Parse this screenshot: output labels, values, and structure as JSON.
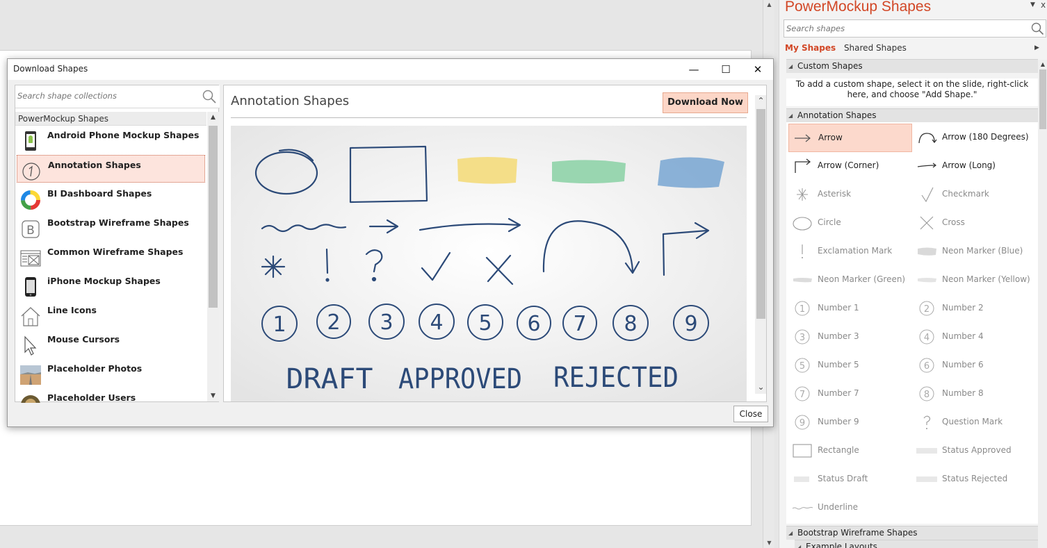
{
  "dialog": {
    "title": "Download Shapes",
    "minimize": "—",
    "maximize": "☐",
    "close": "✕",
    "search_placeholder": "Search shape collections",
    "list_header": "PowerMockup Shapes",
    "items": [
      {
        "label": "Android Phone Mockup Shapes",
        "icon": "android-phone-icon"
      },
      {
        "label": "Annotation Shapes",
        "icon": "annotation-number-icon"
      },
      {
        "label": "BI Dashboard Shapes",
        "icon": "donut-chart-icon"
      },
      {
        "label": "Bootstrap Wireframe Shapes",
        "icon": "bootstrap-b-icon"
      },
      {
        "label": "Common Wireframe Shapes",
        "icon": "wireframe-icon"
      },
      {
        "label": "iPhone Mockup Shapes",
        "icon": "iphone-icon"
      },
      {
        "label": "Line Icons",
        "icon": "house-icon"
      },
      {
        "label": "Mouse Cursors",
        "icon": "cursor-icon"
      },
      {
        "label": "Placeholder Photos",
        "icon": "photo-icon"
      },
      {
        "label": "Placeholder Users",
        "icon": "user-photo-icon"
      }
    ],
    "selected_title": "Annotation Shapes",
    "download_label": "Download Now",
    "preview_words": [
      "DRAFT",
      "APPROVED",
      "REJECTED"
    ],
    "preview_numbers": [
      "1",
      "2",
      "3",
      "4",
      "5",
      "6",
      "7",
      "8",
      "9"
    ],
    "preview_symbols": [
      "*",
      "!",
      "?",
      "✓",
      "✕"
    ],
    "close_label": "Close"
  },
  "pane": {
    "title": "PowerMockup Shapes",
    "menu_glyph": "▼",
    "close_glyph": "x",
    "search_placeholder": "Search shapes",
    "tab_my": "My Shapes",
    "tab_shared": "Shared Shapes",
    "custom_section": "Custom Shapes",
    "custom_message": "To add a custom shape, select it on the slide, right-click here, and choose \"Add Shape.\"",
    "annotation_section": "Annotation Shapes",
    "shapes": [
      {
        "label": "Arrow",
        "icon": "arrow-icon",
        "selected": true
      },
      {
        "label": "Arrow (180 Degrees)",
        "icon": "arrow-180-icon"
      },
      {
        "label": "Arrow (Corner)",
        "icon": "arrow-corner-icon"
      },
      {
        "label": "Arrow (Long)",
        "icon": "arrow-long-icon"
      },
      {
        "label": "Asterisk",
        "icon": "asterisk-icon"
      },
      {
        "label": "Checkmark",
        "icon": "checkmark-icon"
      },
      {
        "label": "Circle",
        "icon": "circle-icon"
      },
      {
        "label": "Cross",
        "icon": "cross-icon"
      },
      {
        "label": "Exclamation Mark",
        "icon": "exclamation-icon"
      },
      {
        "label": "Neon Marker (Blue)",
        "icon": "marker-blue-icon"
      },
      {
        "label": "Neon Marker (Green)",
        "icon": "marker-green-icon"
      },
      {
        "label": "Neon Marker (Yellow)",
        "icon": "marker-yellow-icon"
      },
      {
        "label": "Number 1",
        "icon": "number-1-icon"
      },
      {
        "label": "Number 2",
        "icon": "number-2-icon"
      },
      {
        "label": "Number 3",
        "icon": "number-3-icon"
      },
      {
        "label": "Number 4",
        "icon": "number-4-icon"
      },
      {
        "label": "Number 5",
        "icon": "number-5-icon"
      },
      {
        "label": "Number 6",
        "icon": "number-6-icon"
      },
      {
        "label": "Number 7",
        "icon": "number-7-icon"
      },
      {
        "label": "Number 8",
        "icon": "number-8-icon"
      },
      {
        "label": "Number 9",
        "icon": "number-9-icon"
      },
      {
        "label": "Question Mark",
        "icon": "question-icon"
      },
      {
        "label": "Rectangle",
        "icon": "rectangle-icon"
      },
      {
        "label": "Status Approved",
        "icon": "status-approved-icon"
      },
      {
        "label": "Status Draft",
        "icon": "status-draft-icon"
      },
      {
        "label": "Status Rejected",
        "icon": "status-rejected-icon"
      },
      {
        "label": "Underline",
        "icon": "underline-icon"
      }
    ],
    "bootstrap_section": "Bootstrap Wireframe Shapes",
    "example_section": "Example Layouts"
  },
  "colors": {
    "accent": "#d24726",
    "selection": "#fcd9cc",
    "ink": "#2c4a78"
  }
}
